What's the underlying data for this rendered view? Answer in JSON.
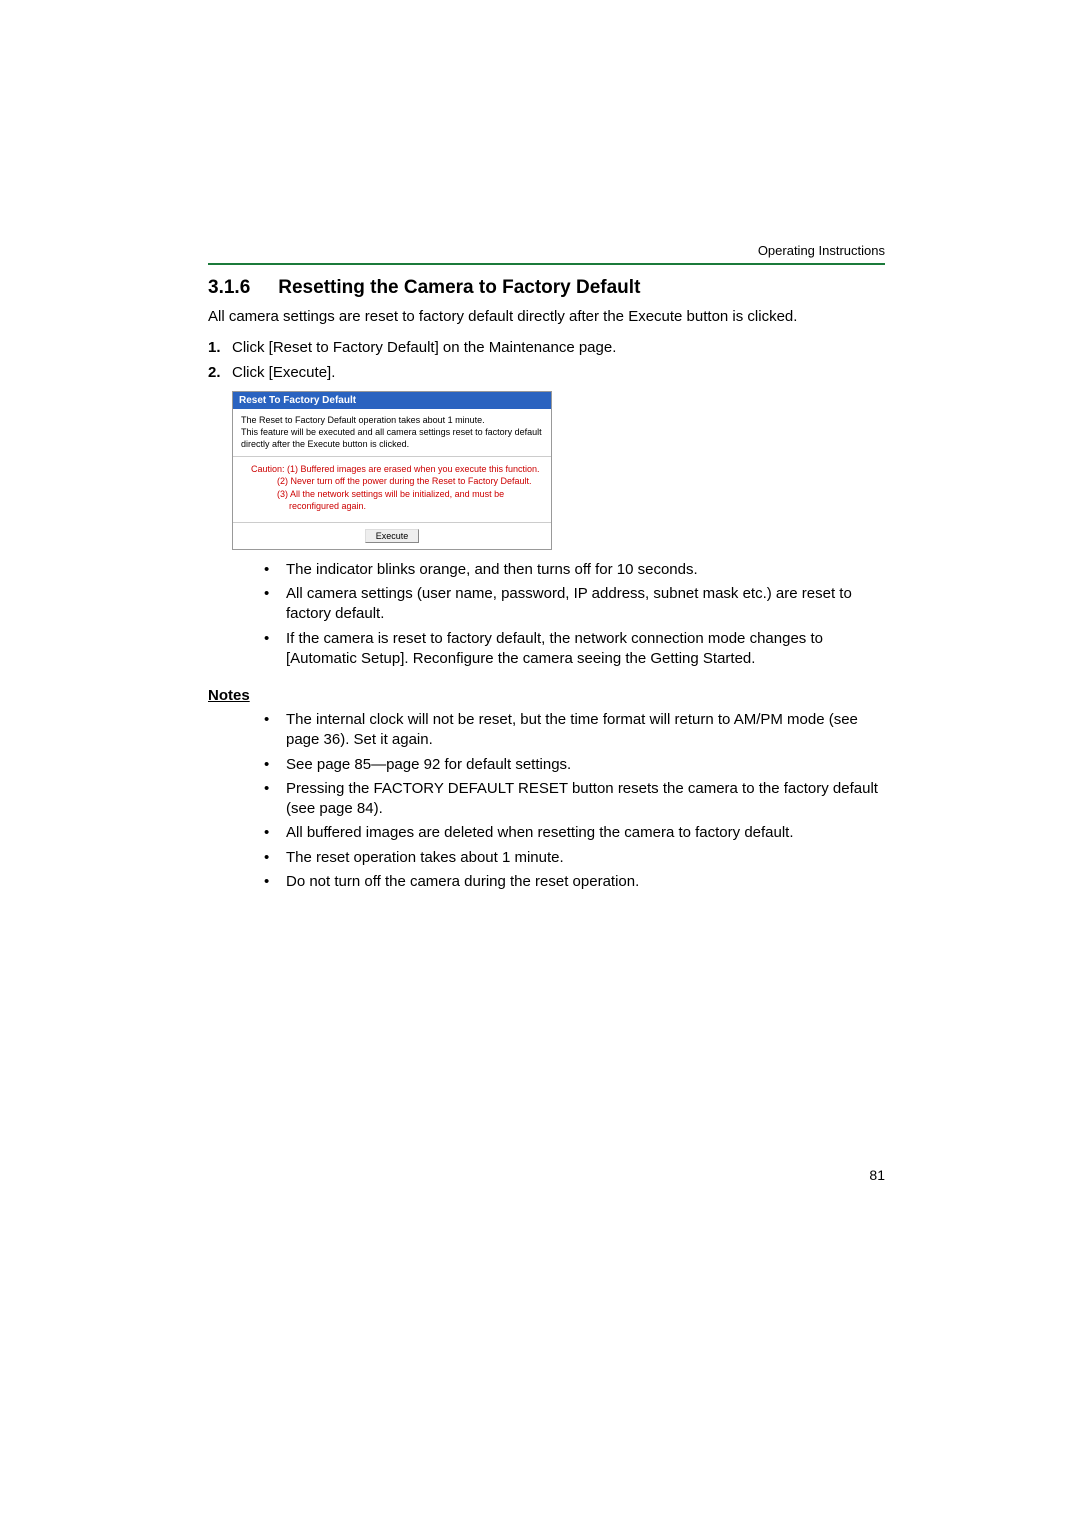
{
  "headerBar": "Operating Instructions",
  "section": {
    "number": "3.1.6",
    "title": "Resetting the Camera to Factory Default"
  },
  "intro": "All camera settings are reset to factory default directly after the Execute button is clicked.",
  "steps": [
    {
      "num": "1.",
      "text": "Click [Reset to Factory Default] on the Maintenance page."
    },
    {
      "num": "2.",
      "text": "Click [Execute]."
    }
  ],
  "dialog": {
    "title": "Reset To Factory Default",
    "body1": "The Reset to Factory Default operation takes about 1 minute.",
    "body2": "This feature will be executed and all camera settings reset to factory default directly after the Execute button is clicked.",
    "cautionLabel": "Caution:",
    "caution1": "(1) Buffered images are erased when you execute this function.",
    "caution2": "(2) Never turn off the power during the Reset to Factory Default.",
    "caution3": "(3) All the network settings will be initialized, and must be reconfigured again.",
    "executeBtn": "Execute"
  },
  "postBullets": [
    "The indicator blinks orange, and then turns off for 10 seconds.",
    "All camera settings (user name, password, IP address, subnet mask etc.) are reset to factory default.",
    "If the camera is reset to factory default, the network connection mode changes to [Automatic Setup]. Reconfigure the camera seeing the Getting Started."
  ],
  "notesHeading": "Notes",
  "notes": [
    "The internal clock will not be reset, but the time format will return to AM/PM mode (see page 36). Set it again.",
    "See page 85—page 92 for default settings.",
    "Pressing the FACTORY DEFAULT RESET button resets the camera to the factory default (see page 84).",
    "All buffered images are deleted when resetting the camera to factory default.",
    "The reset operation takes about 1 minute.",
    "Do not turn off the camera during the reset operation."
  ],
  "pageNumber": "81"
}
